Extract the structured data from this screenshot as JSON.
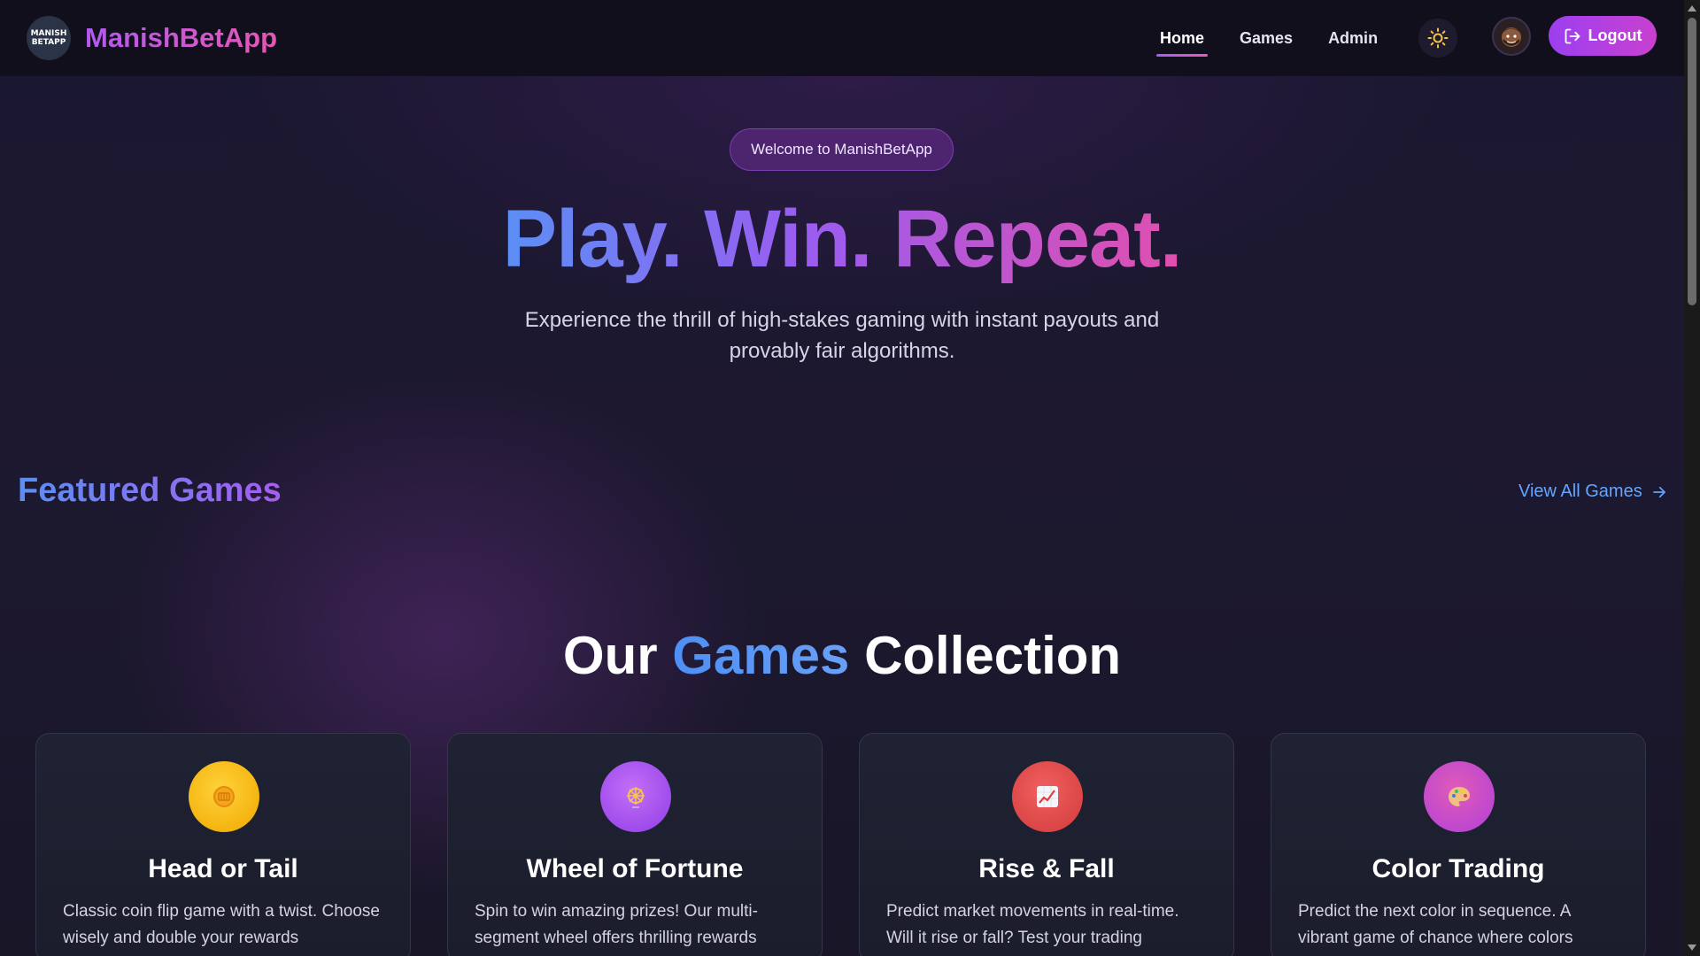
{
  "navbar": {
    "logo_text_line1": "MANISH",
    "logo_text_line2": "BETAPP",
    "brand": "ManishBetApp",
    "links": [
      {
        "label": "Home",
        "active": true
      },
      {
        "label": "Games",
        "active": false
      },
      {
        "label": "Admin",
        "active": false
      }
    ],
    "theme_icon": "sun-icon",
    "avatar_icon": "user-avatar",
    "logout_label": "Logout",
    "logout_icon": "logout-icon"
  },
  "hero": {
    "welcome": "Welcome to ManishBetApp",
    "title": "Play. Win. Repeat.",
    "subtitle": "Experience the thrill of high-stakes gaming with instant payouts and provably fair algorithms."
  },
  "featured": {
    "title": "Featured Games",
    "view_all": "View All Games"
  },
  "collection": {
    "title_part1": "Our",
    "title_accent": "Games",
    "title_part2": "Collection"
  },
  "games": [
    {
      "title": "Head or Tail",
      "description": "Classic coin flip game with a twist. Choose wisely and double your rewards",
      "icon": "coin-icon",
      "color": "#f2b705"
    },
    {
      "title": "Wheel of Fortune",
      "description": "Spin to win amazing prizes! Our multi-segment wheel offers thrilling rewards",
      "icon": "wheel-icon",
      "color": "#a34ff0"
    },
    {
      "title": "Rise & Fall",
      "description": "Predict market movements in real-time. Will it rise or fall? Test your trading",
      "icon": "chart-up-icon",
      "color": "#e04545"
    },
    {
      "title": "Color Trading",
      "description": "Predict the next color in sequence. A vibrant game of chance where colors",
      "icon": "palette-icon",
      "color": "#c64fd6"
    }
  ],
  "colors": {
    "accent_purple": "#a55df5",
    "accent_pink": "#e95cb7",
    "accent_blue": "#5b8ff5",
    "link_blue": "#63a5ff",
    "background": "#161424"
  }
}
